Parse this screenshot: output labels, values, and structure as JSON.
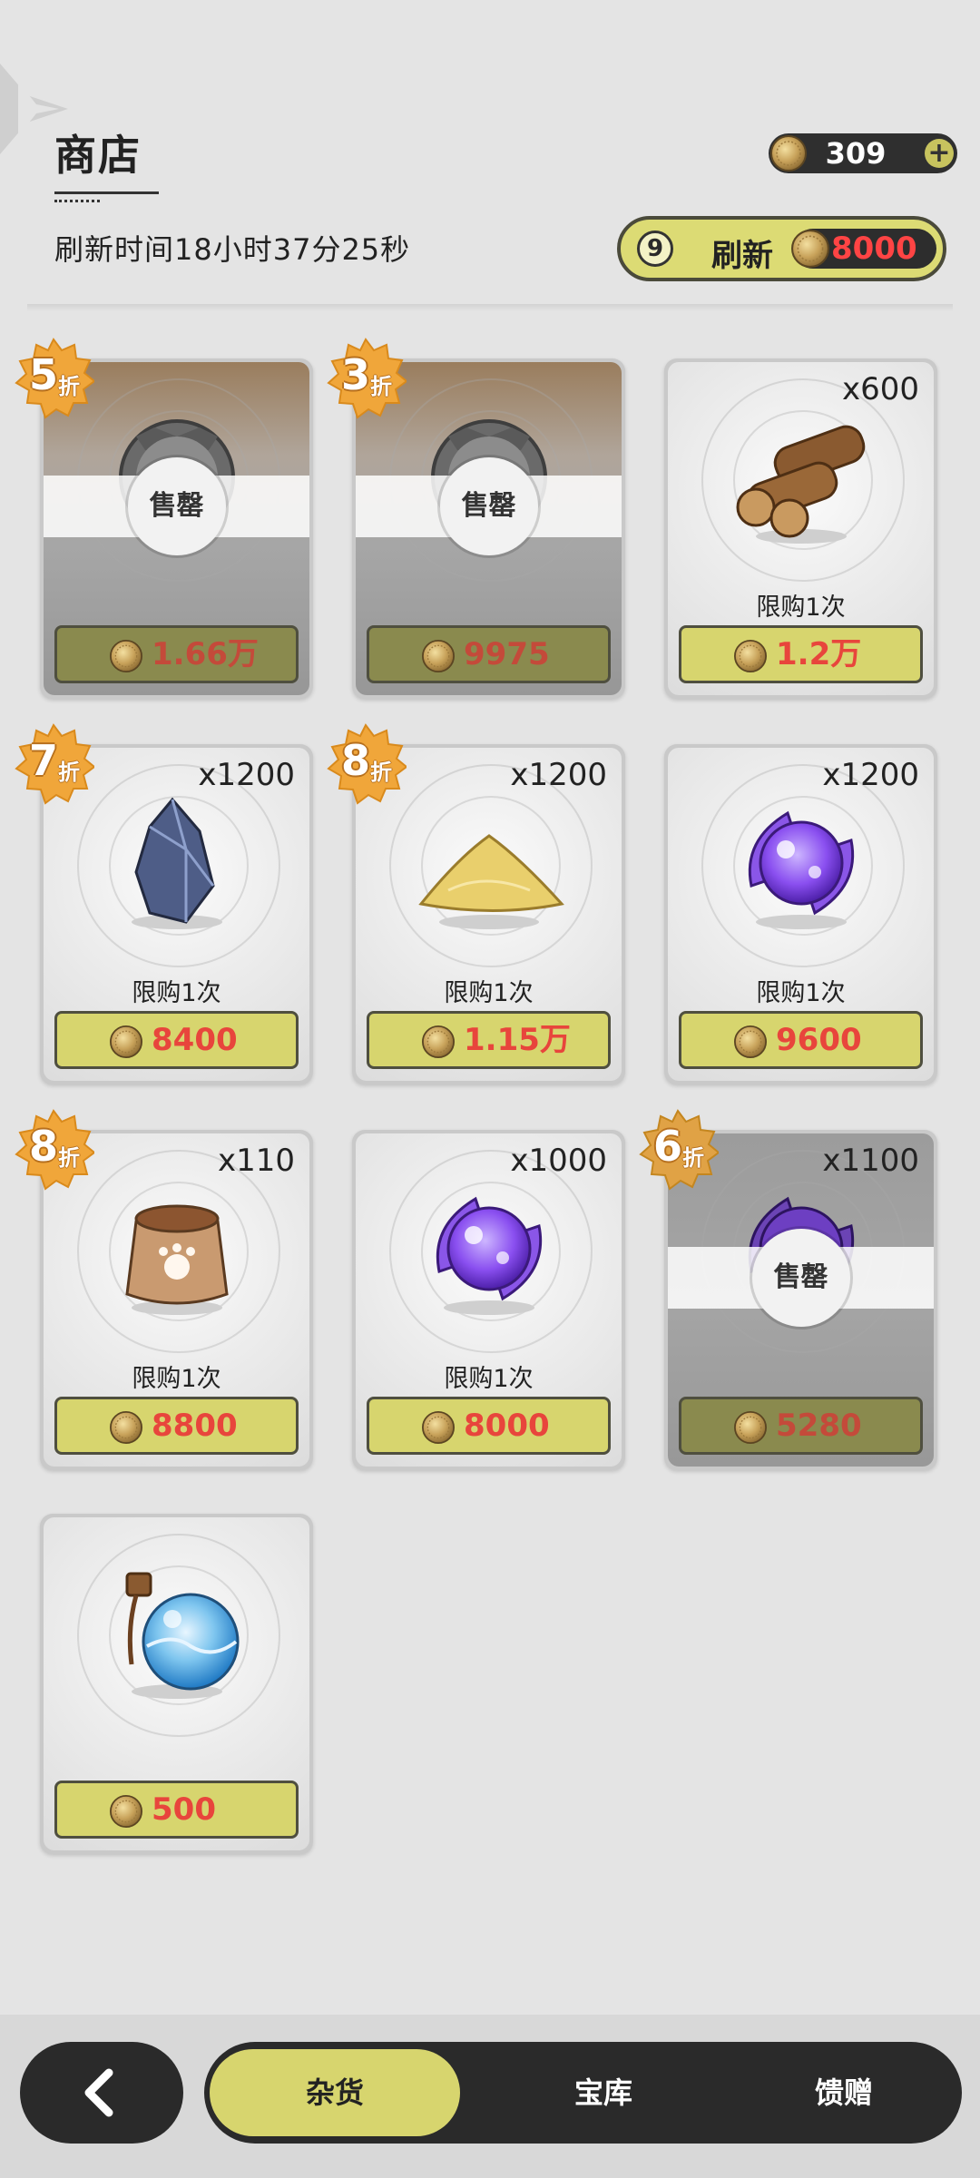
{
  "header": {
    "title": "商店"
  },
  "currency": {
    "amount": "309",
    "add_label": "+"
  },
  "refresh": {
    "timer": "刷新时间18小时37分25秒",
    "count": "9",
    "label": "刷新",
    "cost": "8000"
  },
  "items": [
    {
      "quantity": "",
      "badge": "5",
      "badge_unit": "折",
      "limit": "",
      "price": "1.66万",
      "sold_out": true,
      "sold_out_label": "售罄",
      "icon": "silver-emblem-icon"
    },
    {
      "quantity": "",
      "badge": "3",
      "badge_unit": "折",
      "limit": "",
      "price": "9975",
      "sold_out": true,
      "sold_out_label": "售罄",
      "icon": "silver-emblem-icon"
    },
    {
      "quantity": "x600",
      "badge": "",
      "badge_unit": "",
      "limit": "限购1次",
      "price": "1.2万",
      "sold_out": false,
      "icon": "wood-logs-icon"
    },
    {
      "quantity": "x1200",
      "badge": "7",
      "badge_unit": "折",
      "limit": "限购1次",
      "price": "8400",
      "sold_out": false,
      "icon": "crystal-ore-icon"
    },
    {
      "quantity": "x1200",
      "badge": "8",
      "badge_unit": "折",
      "limit": "限购1次",
      "price": "1.15万",
      "sold_out": false,
      "icon": "sand-pile-icon"
    },
    {
      "quantity": "x1200",
      "badge": "",
      "badge_unit": "",
      "limit": "限购1次",
      "price": "9600",
      "sold_out": false,
      "icon": "purple-orb-icon"
    },
    {
      "quantity": "x110",
      "badge": "8",
      "badge_unit": "折",
      "limit": "限购1次",
      "price": "8800",
      "sold_out": false,
      "icon": "food-sack-icon"
    },
    {
      "quantity": "x1000",
      "badge": "",
      "badge_unit": "",
      "limit": "限购1次",
      "price": "8000",
      "sold_out": false,
      "icon": "purple-orb-icon"
    },
    {
      "quantity": "x1100",
      "badge": "6",
      "badge_unit": "折",
      "limit": "",
      "price": "5280",
      "sold_out": true,
      "sold_out_label": "售罄",
      "icon": "purple-orb-icon"
    },
    {
      "quantity": "",
      "badge": "",
      "badge_unit": "",
      "limit": "",
      "price": "500",
      "sold_out": false,
      "icon": "water-flask-icon"
    }
  ],
  "nav": {
    "tabs": [
      "杂货",
      "宝库",
      "馈赠"
    ],
    "active_tab": "杂货"
  },
  "colors": {
    "accent": "#d7d56e",
    "price": "#e8453c",
    "dark": "#2a2a2a",
    "badge": "#f0a63a"
  }
}
